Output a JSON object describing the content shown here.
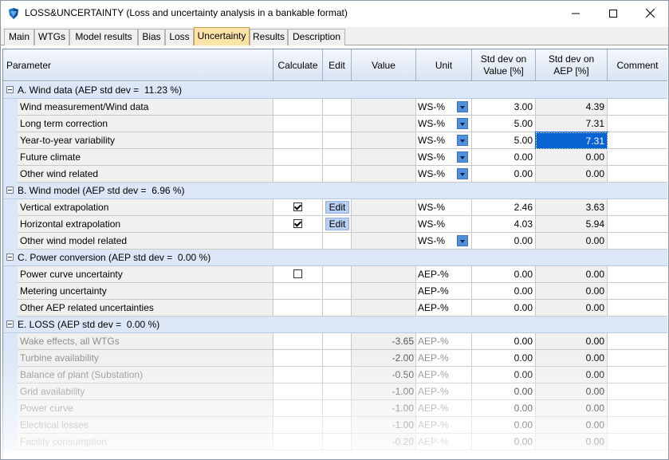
{
  "window": {
    "title": "LOSS&UNCERTAINTY (Loss and uncertainty analysis in a bankable format)",
    "app_icon": "windpro-shield-icon"
  },
  "tabs": [
    {
      "label": "Main",
      "active": false
    },
    {
      "label": "WTGs",
      "active": false
    },
    {
      "label": "Model results",
      "active": false
    },
    {
      "label": "Bias",
      "active": false
    },
    {
      "label": "Loss",
      "active": false
    },
    {
      "label": "Uncertainty",
      "active": true
    },
    {
      "label": "Results",
      "active": false
    },
    {
      "label": "Description",
      "active": false
    }
  ],
  "columns": {
    "parameter": "Parameter",
    "calculate": "Calculate",
    "edit": "Edit",
    "value": "Value",
    "unit": "Unit",
    "std_value": "Std dev on\nValue [%]",
    "std_aep": "Std dev on\nAEP [%]",
    "comment": "Comment"
  },
  "groups": [
    {
      "label": "A. Wind data (AEP std dev =  11.23 %)",
      "rows": [
        {
          "param": "Wind measurement/Wind data",
          "calc": "",
          "edit": "",
          "value": "",
          "unit": "WS-%",
          "dropdown": true,
          "sdv": "3.00",
          "sda": "4.39"
        },
        {
          "param": "Long term correction",
          "calc": "",
          "edit": "",
          "value": "",
          "unit": "WS-%",
          "dropdown": true,
          "sdv": "5.00",
          "sda": "7.31"
        },
        {
          "param": "Year-to-year variability",
          "calc": "",
          "edit": "",
          "value": "",
          "unit": "WS-%",
          "dropdown": true,
          "sdv": "5.00",
          "sda": "7.31",
          "selected": true
        },
        {
          "param": "Future climate",
          "calc": "",
          "edit": "",
          "value": "",
          "unit": "WS-%",
          "dropdown": true,
          "sdv": "0.00",
          "sda": "0.00"
        },
        {
          "param": "Other wind related",
          "calc": "",
          "edit": "",
          "value": "",
          "unit": "WS-%",
          "dropdown": true,
          "sdv": "0.00",
          "sda": "0.00"
        }
      ]
    },
    {
      "label": "B. Wind model (AEP std dev =  6.96 %)",
      "rows": [
        {
          "param": "Vertical extrapolation",
          "calc": "on",
          "edit": "Edit",
          "value": "",
          "unit": "WS-%",
          "dropdown": false,
          "sdv": "2.46",
          "sda": "3.63"
        },
        {
          "param": "Horizontal extrapolation",
          "calc": "on",
          "edit": "Edit",
          "value": "",
          "unit": "WS-%",
          "dropdown": false,
          "sdv": "4.03",
          "sda": "5.94"
        },
        {
          "param": "Other wind model related",
          "calc": "",
          "edit": "",
          "value": "",
          "unit": "WS-%",
          "dropdown": true,
          "sdv": "0.00",
          "sda": "0.00"
        }
      ]
    },
    {
      "label": "C. Power conversion (AEP std dev =  0.00 %)",
      "rows": [
        {
          "param": "Power curve uncertainty",
          "calc": "off",
          "edit": "",
          "value": "",
          "unit": "AEP-%",
          "dropdown": false,
          "sdv": "0.00",
          "sda": "0.00"
        },
        {
          "param": "Metering uncertainty",
          "calc": "",
          "edit": "",
          "value": "",
          "unit": "AEP-%",
          "dropdown": false,
          "sdv": "0.00",
          "sda": "0.00"
        },
        {
          "param": "Other AEP related uncertainties",
          "calc": "",
          "edit": "",
          "value": "",
          "unit": "AEP-%",
          "dropdown": false,
          "sdv": "0.00",
          "sda": "0.00"
        }
      ]
    },
    {
      "label": "E. LOSS (AEP std dev =  0.00 %)",
      "dim": true,
      "rows": [
        {
          "param": "Wake effects, all WTGs",
          "calc": "",
          "edit": "",
          "value": "-3.65",
          "unit": "AEP-%",
          "dropdown": false,
          "sdv": "0.00",
          "sda": "0.00"
        },
        {
          "param": "Turbine availability",
          "calc": "",
          "edit": "",
          "value": "-2.00",
          "unit": "AEP-%",
          "dropdown": false,
          "sdv": "0.00",
          "sda": "0.00"
        },
        {
          "param": "Balance of plant (Substation)",
          "calc": "",
          "edit": "",
          "value": "-0.50",
          "unit": "AEP-%",
          "dropdown": false,
          "sdv": "0.00",
          "sda": "0.00"
        },
        {
          "param": "Grid availability",
          "calc": "",
          "edit": "",
          "value": "-1.00",
          "unit": "AEP-%",
          "dropdown": false,
          "sdv": "0.00",
          "sda": "0.00"
        },
        {
          "param": "Power curve",
          "calc": "",
          "edit": "",
          "value": "-1.00",
          "unit": "AEP-%",
          "dropdown": false,
          "sdv": "0.00",
          "sda": "0.00"
        },
        {
          "param": "Electrical losses",
          "calc": "",
          "edit": "",
          "value": "-1.00",
          "unit": "AEP-%",
          "dropdown": false,
          "sdv": "0.00",
          "sda": "0.00"
        },
        {
          "param": "Facility consumption",
          "calc": "",
          "edit": "",
          "value": "-0.20",
          "unit": "AEP-%",
          "dropdown": false,
          "sdv": "0.00",
          "sda": "0.00"
        }
      ]
    }
  ]
}
